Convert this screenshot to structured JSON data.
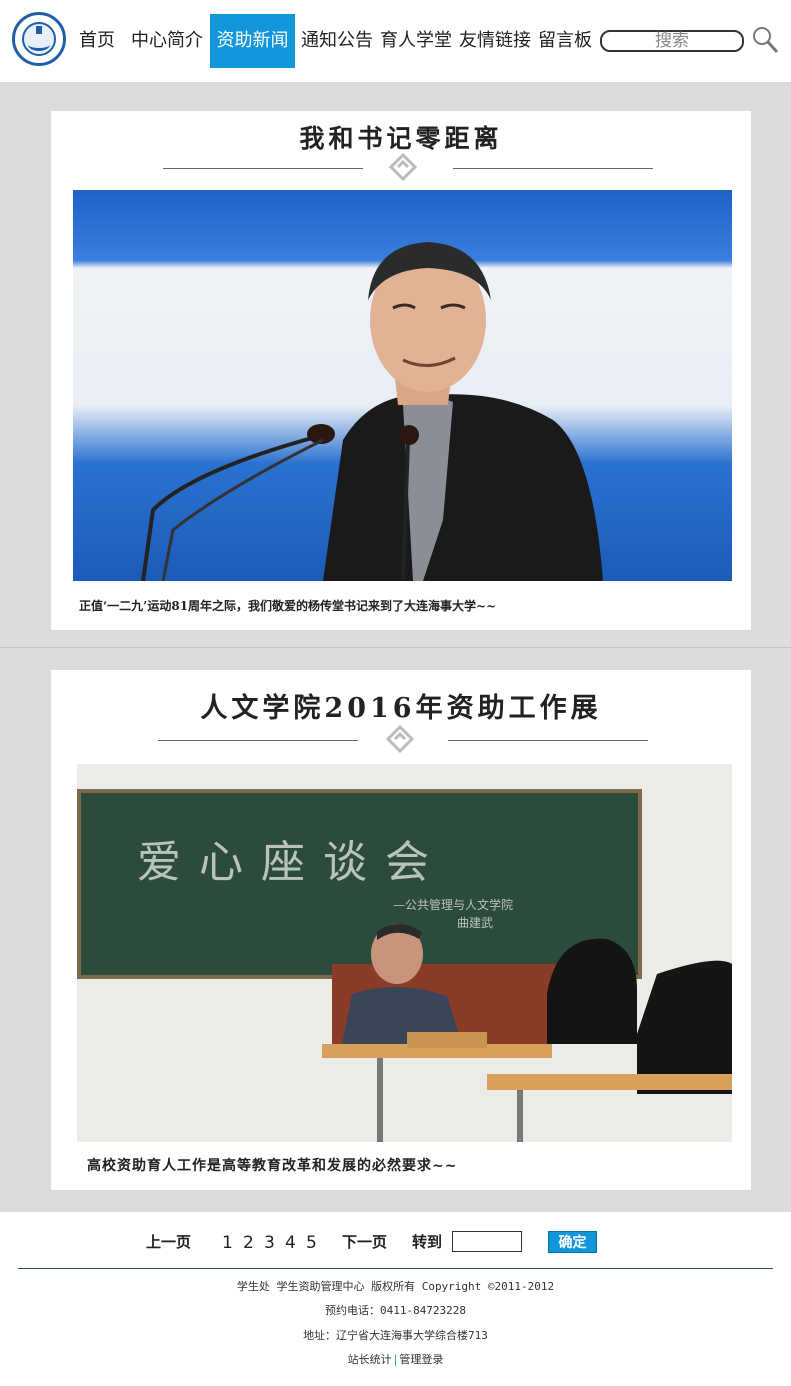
{
  "header": {
    "nav": [
      "首页",
      "中心简介",
      "资助新闻",
      "通知公告",
      "育人学堂",
      "友情链接",
      "留言板"
    ],
    "active_nav": "资助新闻",
    "search_placeholder": "搜索",
    "accent_color": "#1296db"
  },
  "articles": [
    {
      "title": "我和书记零距离",
      "caption": "正值‘一二九’运动81周年之际，我们敬爱的杨传堂书记来到了大连海事大学~~"
    },
    {
      "title": "人文学院2016年资助工作展",
      "caption": "高校资助育人工作是高等教育改革和发展的必然要求~~",
      "board_text": "爱心座谈会",
      "board_subtext": "—公共管理与人文学院",
      "board_name": "曲建武"
    }
  ],
  "pager": {
    "prev": "上一页",
    "pages": [
      "1",
      "2",
      "3",
      "4",
      "5"
    ],
    "next": "下一页",
    "goto": "转到",
    "confirm": "确定"
  },
  "footer": {
    "copyright": "学生处 学生资助管理中心 版权所有 Copyright ©2011-2012",
    "phone": "预约电话：0411-84723228",
    "address": "地址：辽宁省大连海事大学综合楼713",
    "stats_link": "站长统计",
    "admin_link": "管理登录"
  }
}
